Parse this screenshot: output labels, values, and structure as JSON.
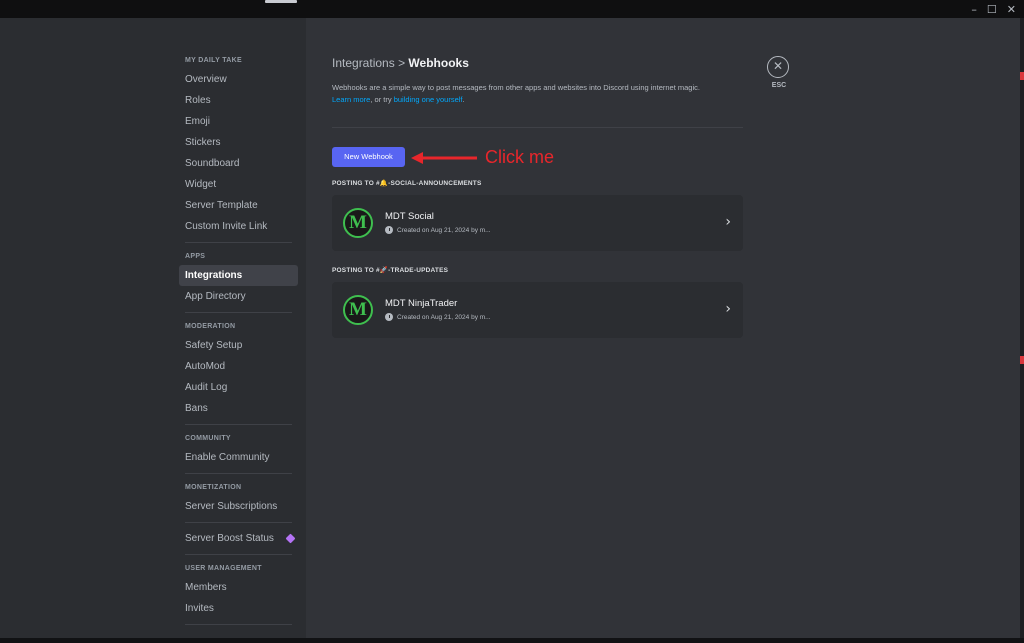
{
  "window": {
    "controls": [
      "–",
      "☐",
      "✕"
    ]
  },
  "sidebar": {
    "sections": [
      {
        "header": "MY DAILY TAKE",
        "items": [
          {
            "label": "Overview"
          },
          {
            "label": "Roles"
          },
          {
            "label": "Emoji"
          },
          {
            "label": "Stickers"
          },
          {
            "label": "Soundboard"
          },
          {
            "label": "Widget"
          },
          {
            "label": "Server Template"
          },
          {
            "label": "Custom Invite Link"
          }
        ]
      },
      {
        "header": "APPS",
        "items": [
          {
            "label": "Integrations",
            "active": true
          },
          {
            "label": "App Directory"
          }
        ]
      },
      {
        "header": "MODERATION",
        "items": [
          {
            "label": "Safety Setup"
          },
          {
            "label": "AutoMod"
          },
          {
            "label": "Audit Log"
          },
          {
            "label": "Bans"
          }
        ]
      },
      {
        "header": "COMMUNITY",
        "items": [
          {
            "label": "Enable Community"
          }
        ]
      },
      {
        "header": "MONETIZATION",
        "items": [
          {
            "label": "Server Subscriptions"
          }
        ]
      },
      {
        "header": "",
        "items": [
          {
            "label": "Server Boost Status",
            "icon": "boost-gem-icon"
          }
        ]
      },
      {
        "header": "USER MANAGEMENT",
        "items": [
          {
            "label": "Members"
          },
          {
            "label": "Invites"
          }
        ]
      }
    ]
  },
  "main": {
    "breadcrumb": {
      "parent": "Integrations",
      "separator": ">",
      "current": "Webhooks"
    },
    "description": {
      "text": "Webhooks are a simple way to post messages from other apps and websites into Discord using internet magic.",
      "learn_more": "Learn more",
      "middle": ", or try ",
      "build_link": "building one yourself",
      "end": "."
    },
    "new_webhook_label": "New Webhook",
    "webhooks": [
      {
        "posting_label": "POSTING TO #🔔-SOCIAL-ANNOUNCEMENTS",
        "name": "MDT Social",
        "avatar_letter": "M",
        "created": "Created on Aug 21, 2024 by m..."
      },
      {
        "posting_label": "POSTING TO #🚀-TRADE-UPDATES",
        "name": "MDT NinjaTrader",
        "avatar_letter": "M",
        "created": "Created on Aug 21, 2024 by m..."
      }
    ]
  },
  "close": {
    "icon": "close-icon",
    "label": "ESC"
  },
  "annotation": {
    "text": "Click me",
    "color": "#e8262b"
  },
  "colors": {
    "accent": "#5865f2",
    "link": "#00a8fc",
    "avatar_green": "#3fbf4f"
  }
}
